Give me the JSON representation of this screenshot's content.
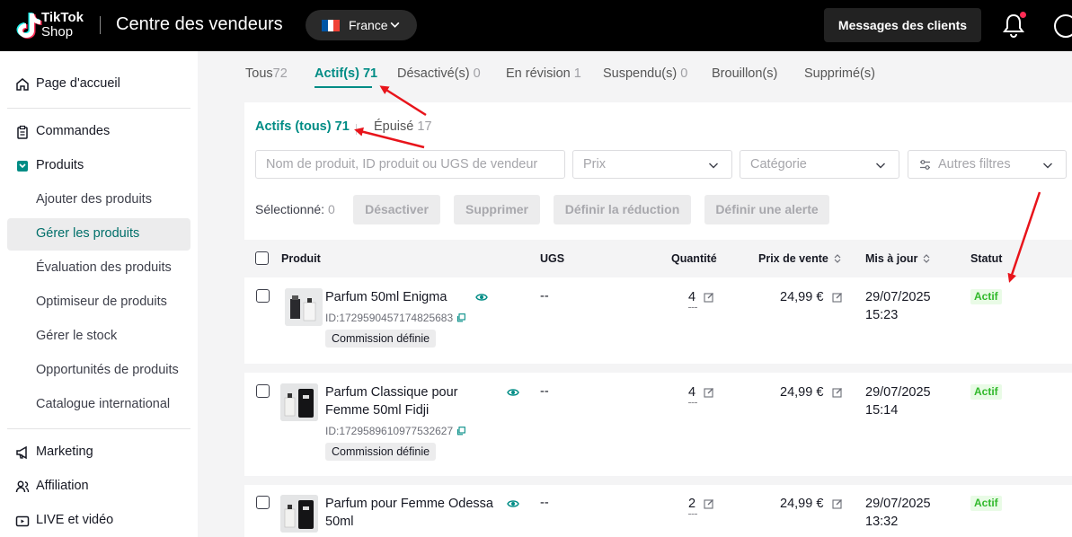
{
  "header": {
    "logo_line1": "TikTok",
    "logo_line2": "Shop",
    "title": "Centre des vendeurs",
    "country": "France",
    "messages_label": "Messages des clients"
  },
  "sidebar": {
    "items": [
      {
        "label": "Page d'accueil",
        "icon": "home-icon"
      },
      {
        "label": "Commandes",
        "icon": "clipboard-icon"
      },
      {
        "label": "Produits",
        "icon": "product-box-icon"
      },
      {
        "label": "Ajouter des produits"
      },
      {
        "label": "Gérer les produits",
        "active": true
      },
      {
        "label": "Évaluation des produits"
      },
      {
        "label": "Optimiseur de produits"
      },
      {
        "label": "Gérer le stock"
      },
      {
        "label": "Opportunités de produits"
      },
      {
        "label": "Catalogue international"
      },
      {
        "label": "Marketing",
        "icon": "megaphone-icon"
      },
      {
        "label": "Affiliation",
        "icon": "users-icon"
      },
      {
        "label": "LIVE et vidéo",
        "icon": "video-icon"
      }
    ]
  },
  "status_tabs": [
    {
      "label": "Tous",
      "count": "72"
    },
    {
      "label": "Actif(s)",
      "count": "71",
      "active": true
    },
    {
      "label": "Désactivé(s)",
      "count": "0"
    },
    {
      "label": "En révision",
      "count": "1"
    },
    {
      "label": "Suspendu(s)",
      "count": "0"
    },
    {
      "label": "Brouillon(s)",
      "count": ""
    },
    {
      "label": "Supprimé(s)",
      "count": ""
    }
  ],
  "sub_tabs": {
    "active_label": "Actifs (tous)",
    "active_count": "71",
    "other_label": "Épuisé",
    "other_count": "17"
  },
  "filters": {
    "search_placeholder": "Nom de produit, ID produit ou UGS de vendeur",
    "price_placeholder": "Prix",
    "category_placeholder": "Catégorie",
    "more_filters_label": "Autres filtres"
  },
  "bulk": {
    "selected_label": "Sélectionné:",
    "selected_count": "0",
    "deactivate": "Désactiver",
    "delete": "Supprimer",
    "set_discount": "Définir la réduction",
    "set_alert": "Définir une alerte"
  },
  "table": {
    "headers": {
      "product": "Produit",
      "sku": "UGS",
      "quantity": "Quantité",
      "price": "Prix de vente",
      "updated": "Mis à jour",
      "status": "Statut"
    },
    "rows": [
      {
        "name": "Parfum 50ml Enigma",
        "id": "ID:1729590457174825683",
        "tag": "Commission définie",
        "sku": "--",
        "quantity": "4",
        "price": "24,99 €",
        "date": "29/07/2025",
        "time": "15:23",
        "status": "Actif"
      },
      {
        "name": "Parfum Classique pour Femme 50ml Fidji",
        "id": "ID:1729589610977532627",
        "tag": "Commission définie",
        "sku": "--",
        "quantity": "4",
        "price": "24,99 €",
        "date": "29/07/2025",
        "time": "15:14",
        "status": "Actif"
      },
      {
        "name": "Parfum pour Femme Odessa 50ml",
        "id": "",
        "tag": "",
        "sku": "--",
        "quantity": "2",
        "price": "24,99 €",
        "date": "29/07/2025",
        "time": "13:32",
        "status": "Actif"
      }
    ]
  },
  "colors": {
    "accent": "#008c85",
    "status_active": "#31b92b",
    "annotation_arrow": "#e8141b"
  }
}
